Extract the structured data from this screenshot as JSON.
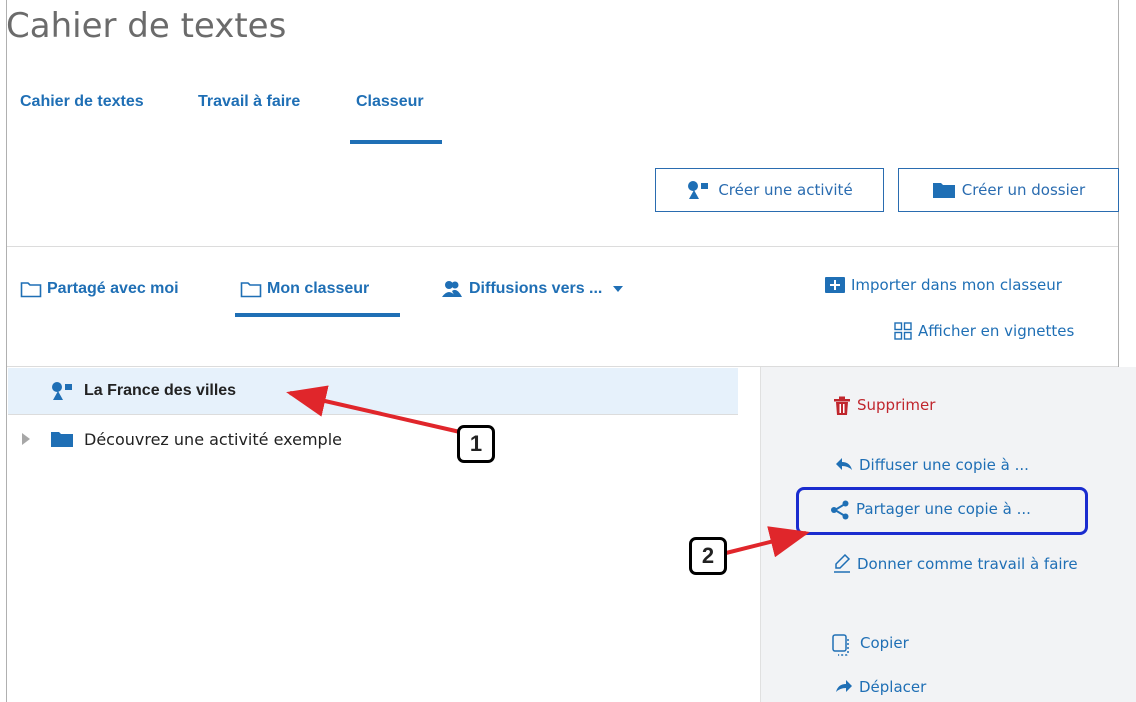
{
  "title": "Cahier de textes",
  "tabs": [
    {
      "label": "Cahier de textes",
      "active": false
    },
    {
      "label": "Travail à faire",
      "active": false
    },
    {
      "label": "Classeur",
      "active": true
    }
  ],
  "toolbar": {
    "create_activity": "Créer une activité",
    "create_folder": "Créer un dossier"
  },
  "subtabs": {
    "shared": "Partagé avec moi",
    "my_binder": "Mon classeur",
    "broadcasts": "Diffusions vers ..."
  },
  "right_actions": {
    "import": "Importer dans mon classeur",
    "thumbnails": "Afficher en vignettes"
  },
  "list": [
    {
      "label": "La France des villes",
      "selected": true
    },
    {
      "label": "Découvrez une activité exemple",
      "selected": false
    }
  ],
  "panel_actions": {
    "delete": "Supprimer",
    "broadcast_copy": "Diffuser une copie à ...",
    "share_copy": "Partager une copie à ...",
    "assign_homework": "Donner comme travail à faire",
    "copy": "Copier",
    "move": "Déplacer"
  },
  "callouts": {
    "one": "1",
    "two": "2"
  },
  "colors": {
    "accent": "#1f6fb5",
    "delete": "#c0262d",
    "selected_row": "#e6f1fb",
    "panel_bg": "#f2f3f5",
    "highlight_border": "#1a2ccf",
    "arrow": "#e0262b"
  }
}
